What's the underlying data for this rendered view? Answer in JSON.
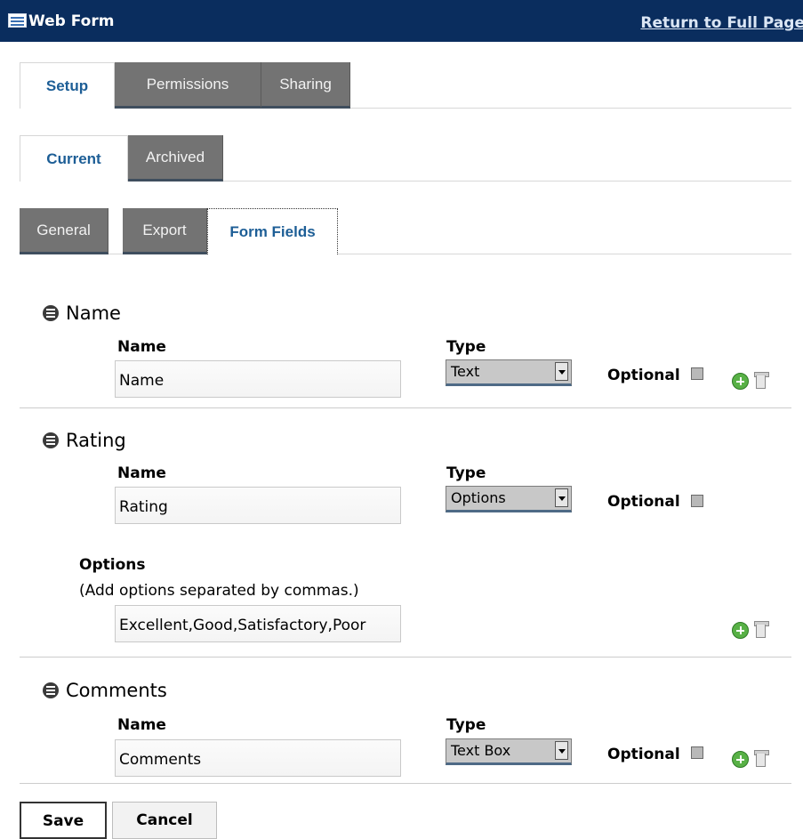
{
  "window": {
    "title": "Web Form",
    "return_link": "Return to Full Page"
  },
  "tabs_top": [
    {
      "label": "Setup",
      "active": true
    },
    {
      "label": "Permissions",
      "active": false
    },
    {
      "label": "Sharing",
      "active": false
    }
  ],
  "tabs_state": [
    {
      "label": "Current",
      "active": true
    },
    {
      "label": "Archived",
      "active": false
    }
  ],
  "tabs_section": [
    {
      "label": "General",
      "active": false
    },
    {
      "label": "Export",
      "active": false
    },
    {
      "label": "Form Fields",
      "active": true
    }
  ],
  "fields": [
    {
      "title": "Name",
      "name_label": "Name",
      "name_value": "Name",
      "type_label": "Type",
      "type_value": "Text",
      "optional_label": "Optional",
      "optional_checked": false
    },
    {
      "title": "Rating",
      "name_label": "Name",
      "name_value": "Rating",
      "type_label": "Type",
      "type_value": "Options",
      "optional_label": "Optional",
      "optional_checked": false,
      "options_label": "Options",
      "options_hint": "(Add options separated by commas.)",
      "options_value": "Excellent,Good,Satisfactory,Poor"
    },
    {
      "title": "Comments",
      "name_label": "Name",
      "name_value": "Comments",
      "type_label": "Type",
      "type_value": "Text Box",
      "optional_label": "Optional",
      "optional_checked": false
    }
  ],
  "actions": {
    "save_label": "Save",
    "cancel_label": "Cancel"
  },
  "colors": {
    "title_bar": "#0a2d5e",
    "active_tab_text": "#1d5e96",
    "inactive_tab": "#737373",
    "add_icon": "#58b146"
  },
  "icons": {
    "window": "form-icon",
    "drag": "drag-handle-icon",
    "add": "add-icon",
    "delete": "delete-icon"
  }
}
